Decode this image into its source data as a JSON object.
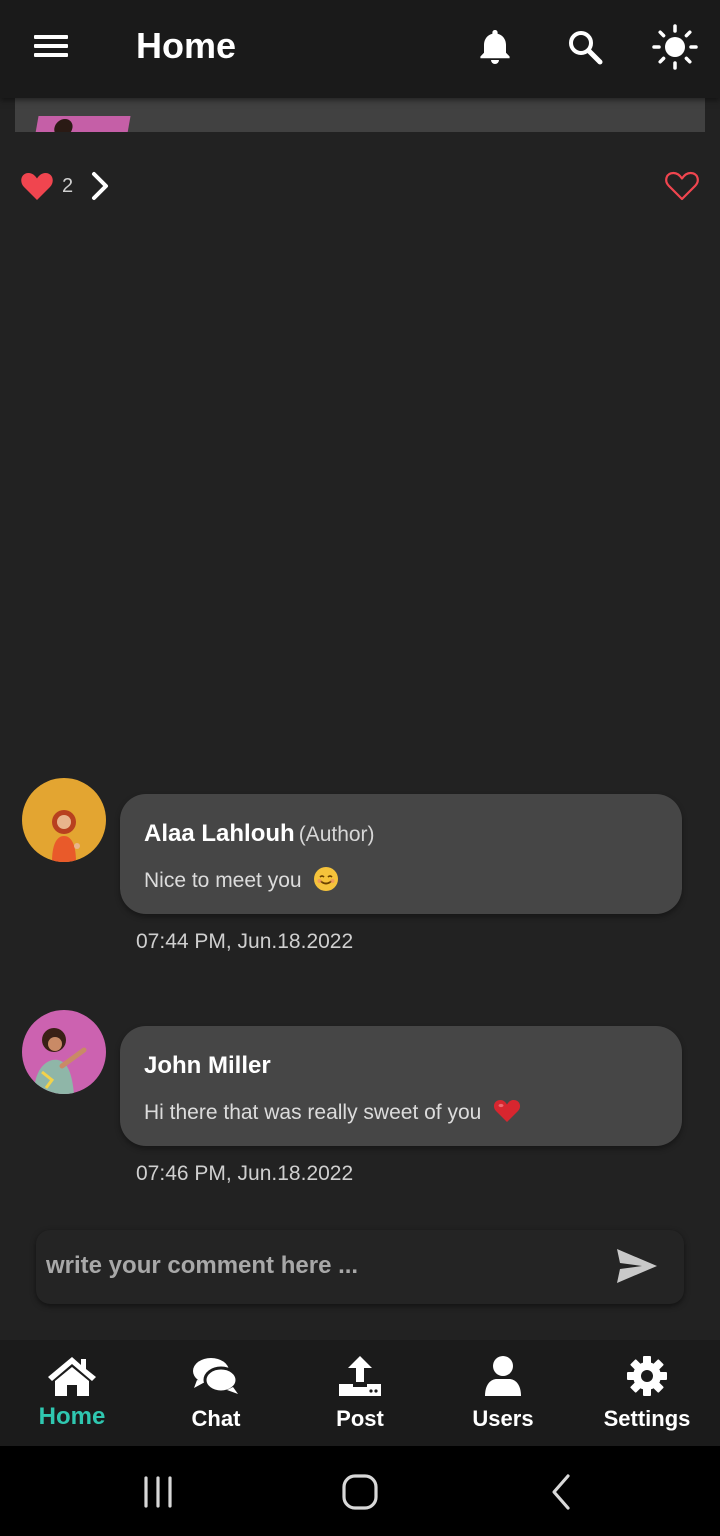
{
  "app_bar": {
    "title": "Home",
    "icons": [
      "menu-icon",
      "bell-icon",
      "search-icon",
      "sun-icon"
    ]
  },
  "post": {
    "like_count": "2",
    "icons": [
      "heart-filled-icon",
      "chevron-right-icon",
      "heart-outline-icon"
    ]
  },
  "comments": [
    {
      "name": "Alaa Lahlouh",
      "role": "(Author)",
      "text": "Nice to meet you",
      "emoji": "smiling-face-emoji",
      "time": "07:44 PM,  Jun.18.2022"
    },
    {
      "name": "John Miller",
      "role": "",
      "text": "Hi there that was really sweet of you",
      "emoji": "red-heart-emoji",
      "time": "07:46 PM,  Jun.18.2022"
    }
  ],
  "comment_input": {
    "placeholder": "write your comment here ...",
    "value": ""
  },
  "bottom_nav": {
    "items": [
      {
        "label": "Home",
        "icon": "home-icon",
        "active": true
      },
      {
        "label": "Chat",
        "icon": "chat-icon",
        "active": false
      },
      {
        "label": "Post",
        "icon": "upload-icon",
        "active": false
      },
      {
        "label": "Users",
        "icon": "user-icon",
        "active": false
      },
      {
        "label": "Settings",
        "icon": "gear-icon",
        "active": false
      }
    ]
  },
  "colors": {
    "background": "#222222",
    "app_bar": "#1a1a1a",
    "bubble": "#464646",
    "accent_active": "#2fc7b0",
    "heart": "#f0454f"
  }
}
